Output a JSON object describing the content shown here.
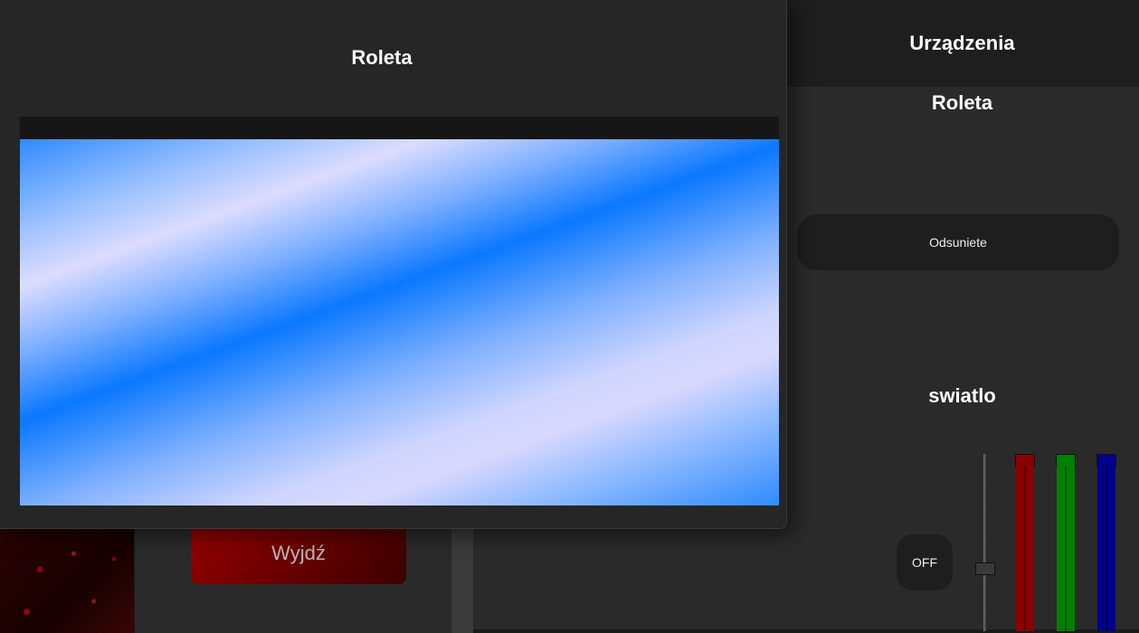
{
  "exit_button": {
    "label": "Wyjdź"
  },
  "devices_panel": {
    "header": "Urządzenia",
    "blind": {
      "title": "Roleta",
      "state_label": "Odsuniete"
    },
    "light": {
      "title": "swiatlo",
      "power_label": "OFF",
      "brightness_level": 0.35,
      "rgb": {
        "red": 1.0,
        "green": 1.0,
        "blue": 1.0
      },
      "colors": {
        "red": "#8b0000",
        "green": "#008000",
        "blue": "#00008b"
      }
    }
  },
  "dialog": {
    "title": "Roleta"
  }
}
